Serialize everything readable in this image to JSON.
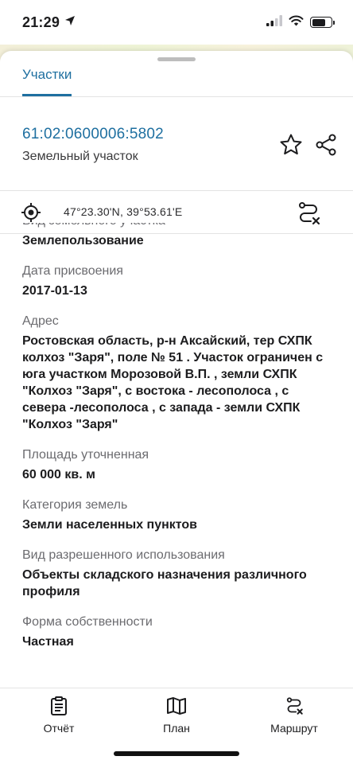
{
  "status_bar": {
    "time": "21:29",
    "icons": [
      "location-arrow-icon",
      "cellular-signal-icon",
      "wifi-icon",
      "battery-icon"
    ]
  },
  "sheet": {
    "tab_label": "Участки",
    "cadastral_number": "61:02:0600006:5802",
    "parcel_type": "Земельный участок",
    "coordinates": "47°23.30'N, 39°53.61'E",
    "accent_color": "#1e6fa0"
  },
  "details": {
    "partial_label": "Вид земельного участка",
    "land_use_type": "Землепользование",
    "assignment_date_label": "Дата присвоения",
    "assignment_date": "2017-01-13",
    "address_label": "Адрес",
    "address": "Ростовская область, р-н Аксайский, тер СХПК колхоз \"Заря\", поле № 51 . Участок ограничен с юга участком Морозовой В.П. , земли СХПК \"Колхоз \"Заря\", с востока - лесополоса , с севера -лесополоса , с запада - земли СХПК \"Колхоз \"Заря\"",
    "area_label": "Площадь уточненная",
    "area": "60 000 кв. м",
    "category_label": "Категория земель",
    "category": "Земли населенных пунктов",
    "permitted_use_label": "Вид разрешенного использования",
    "permitted_use": "Объекты складского назначения различного профиля",
    "ownership_label": "Форма собственности",
    "ownership": "Частная"
  },
  "tabbar": {
    "report_label": "Отчёт",
    "plan_label": "План",
    "route_label": "Маршрут"
  }
}
